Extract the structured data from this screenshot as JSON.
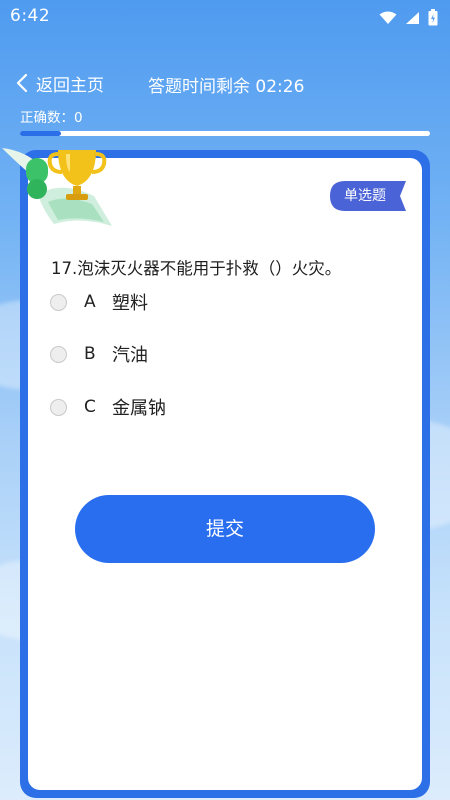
{
  "status_bar": {
    "time": "6:42",
    "icons": [
      "wifi-icon",
      "signal-icon",
      "battery-icon"
    ]
  },
  "header": {
    "back_label": "返回主页",
    "timer_text": "答题时间剩余 02:26"
  },
  "progress": {
    "correct_label": "正确数：0",
    "fraction": 0.1
  },
  "card": {
    "type_badge": "单选题",
    "question": "17.泡沫灭火器不能用于扑救（）火灾。",
    "options": [
      {
        "letter": "A",
        "text": "塑料"
      },
      {
        "letter": "B",
        "text": "汽油"
      },
      {
        "letter": "C",
        "text": "金属钠"
      }
    ],
    "submit_label": "提交"
  },
  "colors": {
    "accent": "#2a6ef0",
    "card_border": "#2d6fe6",
    "badge": "#4a63d6"
  }
}
